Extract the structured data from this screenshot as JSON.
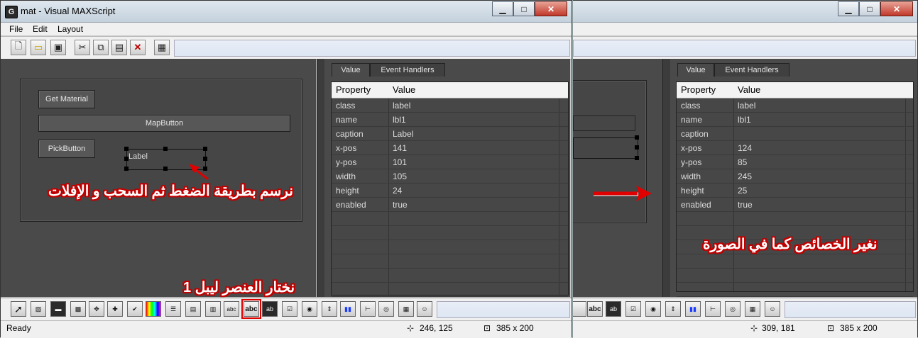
{
  "window": {
    "title": "mat - Visual MAXScript",
    "icon_letter": "G"
  },
  "menu": [
    "File",
    "Edit",
    "Layout"
  ],
  "form": {
    "controls": {
      "get_material": "Get Material",
      "map_button": "MapButton",
      "pick_button": "PickButton",
      "label": "Label"
    }
  },
  "tabs": [
    "Value",
    "Event Handlers"
  ],
  "grid_headers": {
    "property": "Property",
    "value": "Value"
  },
  "left_props": [
    {
      "property": "class",
      "value": "label"
    },
    {
      "property": "name",
      "value": "lbl1"
    },
    {
      "property": "caption",
      "value": "Label"
    },
    {
      "property": "x-pos",
      "value": "141"
    },
    {
      "property": "y-pos",
      "value": "101"
    },
    {
      "property": "width",
      "value": "105"
    },
    {
      "property": "height",
      "value": "24"
    },
    {
      "property": "enabled",
      "value": "true"
    }
  ],
  "right_props": [
    {
      "property": "class",
      "value": "label"
    },
    {
      "property": "name",
      "value": "lbl1"
    },
    {
      "property": "caption",
      "value": ""
    },
    {
      "property": "x-pos",
      "value": "124"
    },
    {
      "property": "y-pos",
      "value": "85"
    },
    {
      "property": "width",
      "value": "245"
    },
    {
      "property": "height",
      "value": "25"
    },
    {
      "property": "enabled",
      "value": "true"
    }
  ],
  "status": {
    "left": {
      "text": "Ready",
      "coords": "246, 125",
      "size": "385 x 200"
    },
    "right": {
      "coords": "309, 181",
      "size": "385 x 200"
    }
  },
  "bottom_toolbar_text": {
    "abc": "abc",
    "ab": "ab"
  },
  "annotations": {
    "draw": "نرسم بطريقة الضغط ثم السحب و الإفلات",
    "choose": "1 نختار العنصر ليبل",
    "change": "نغير الخصائص كما في الصورة"
  },
  "colors": {
    "annotation_outline": "#c00000",
    "arrow": "#e00000",
    "highlight": "#e00000"
  }
}
